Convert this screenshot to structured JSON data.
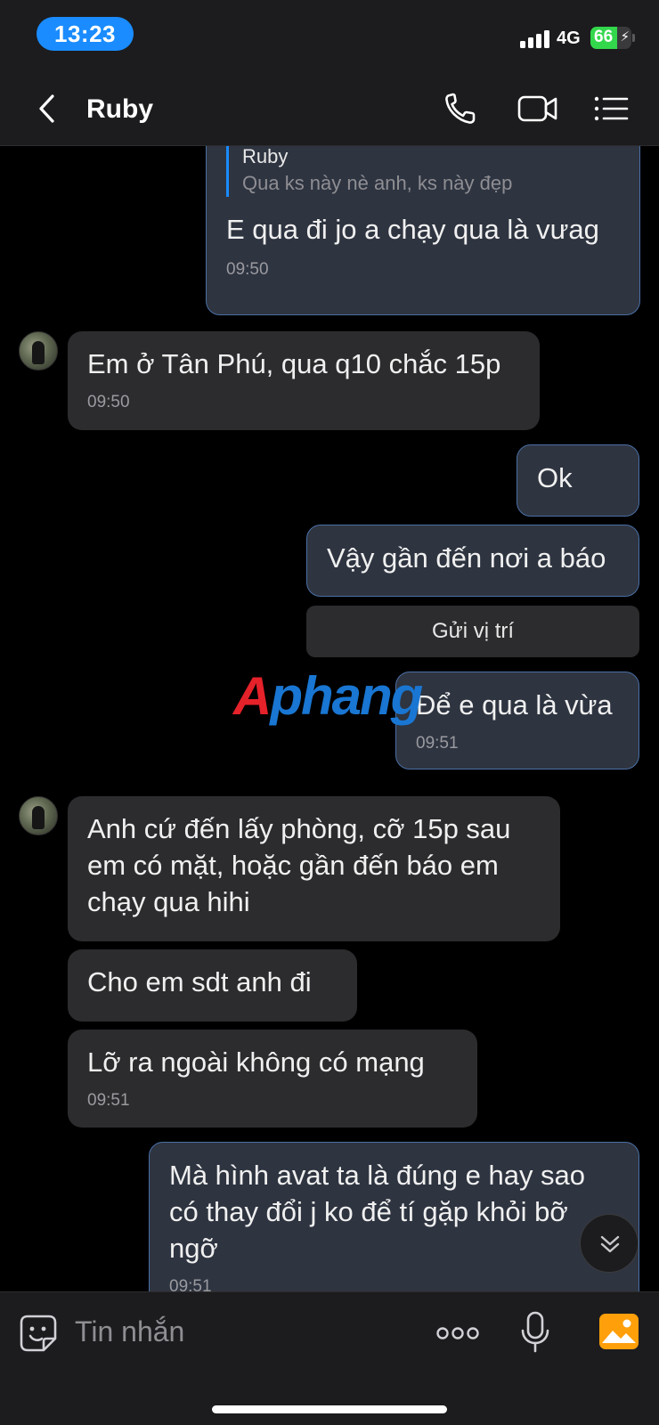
{
  "status_bar": {
    "time": "13:23",
    "network": "4G",
    "battery": "66",
    "battery_level": 0.66
  },
  "header": {
    "title": "Ruby"
  },
  "messages": {
    "m1": {
      "quote_name": "Ruby",
      "quote_text": "Qua ks này nè anh, ks này đẹp",
      "text": "E qua đi jo a chạy qua là vưag",
      "time": "09:50"
    },
    "m2": {
      "text": "Em ở Tân Phú, qua q10 chắc 15p",
      "time": "09:50"
    },
    "m3": {
      "text": "Ok"
    },
    "m4": {
      "text": "Vậy gần đến nơi a báo"
    },
    "m5": {
      "action": "Gửi vị trí"
    },
    "m6": {
      "text": "Để e qua là vừa",
      "time": "09:51"
    },
    "m7": {
      "text": "Anh cứ đến lấy phòng, cỡ 15p sau em có mặt, hoặc gần đến báo em chạy qua hihi"
    },
    "m8": {
      "text": "Cho em sdt anh đi"
    },
    "m9": {
      "text": "Lỡ ra ngoài không có mạng",
      "time": "09:51"
    },
    "m10": {
      "text": "Mà hình avat ta là đúng e hay sao có thay đổi j ko để tí gặp khỏi bỡ ngỡ",
      "time": "09:51"
    }
  },
  "watermark": {
    "part1": "A",
    "part2": "phang"
  },
  "input": {
    "placeholder": "Tin nhắn"
  },
  "colors": {
    "accent": "#1a8cff",
    "outgoing_bg": "#2e3440",
    "incoming_bg": "#2c2c2e",
    "battery": "#32d74b"
  },
  "icons": [
    "back-icon",
    "phone-icon",
    "video-icon",
    "menu-icon",
    "scroll-down-icon",
    "sticker-icon",
    "more-icon",
    "microphone-icon",
    "image-icon"
  ]
}
